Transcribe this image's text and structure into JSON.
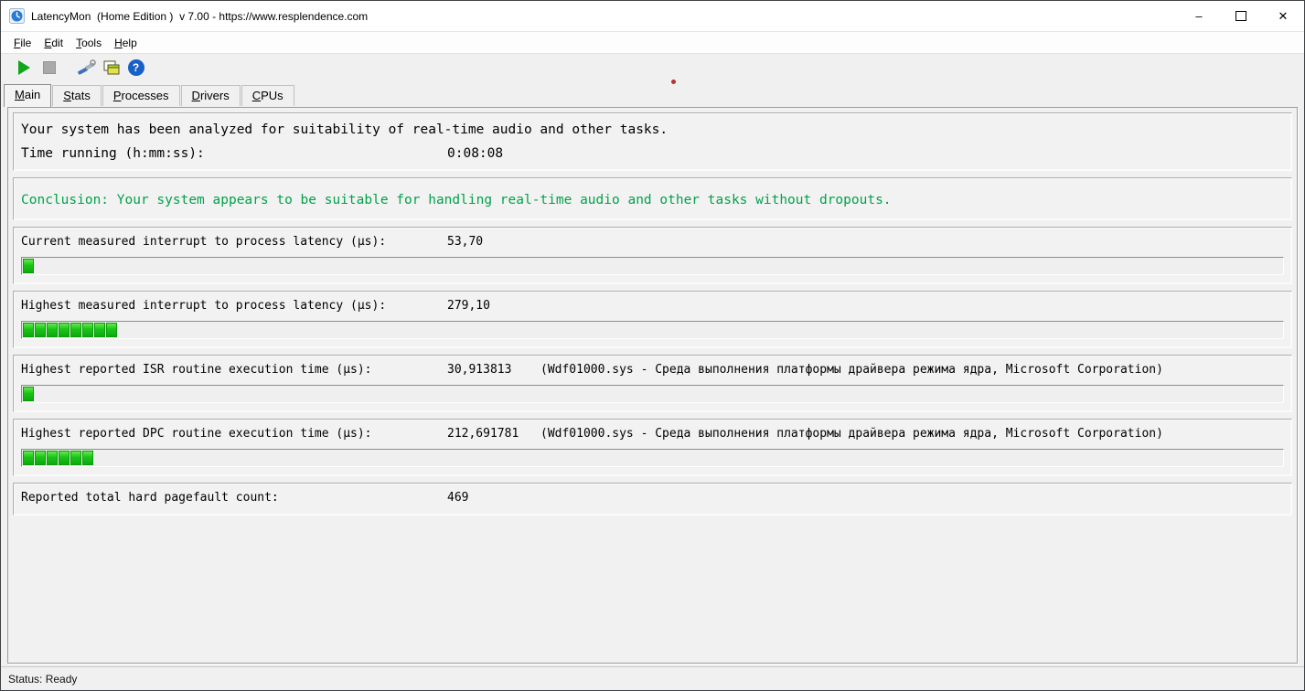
{
  "window": {
    "title": "LatencyMon  (Home Edition )  v 7.00 - https://www.resplendence.com"
  },
  "menubar": {
    "items": [
      {
        "label": "File"
      },
      {
        "label": "Edit"
      },
      {
        "label": "Tools"
      },
      {
        "label": "Help"
      }
    ]
  },
  "toolbar": {
    "buttons": [
      {
        "name": "start-monitor"
      },
      {
        "name": "stop-monitor"
      },
      {
        "name": "edit-options"
      },
      {
        "name": "copy-report"
      },
      {
        "name": "help"
      }
    ],
    "help_glyph": "?"
  },
  "tabs": [
    {
      "label": "Main",
      "active": true
    },
    {
      "label": "Stats",
      "active": false
    },
    {
      "label": "Processes",
      "active": false
    },
    {
      "label": "Drivers",
      "active": false
    },
    {
      "label": "CPUs",
      "active": false
    }
  ],
  "report": {
    "intro": "Your system has been analyzed for suitability of real-time audio and other tasks.",
    "time_running_label": "Time running (h:mm:ss):",
    "time_running_value": "0:08:08",
    "conclusion": "Conclusion: Your system appears to be suitable for handling real-time audio and other tasks without dropouts.",
    "metrics": [
      {
        "label": "Current measured interrupt to process latency (µs):",
        "value": "53,70",
        "detail": "",
        "bar_segments": 1
      },
      {
        "label": "Highest measured interrupt to process latency (µs):",
        "value": "279,10",
        "detail": "",
        "bar_segments": 8
      },
      {
        "label": "Highest reported ISR routine execution time (µs):",
        "value": "30,913813",
        "detail": "(Wdf01000.sys - Среда выполнения платформы драйвера режима ядра, Microsoft Corporation)",
        "bar_segments": 1
      },
      {
        "label": "Highest reported DPC routine execution time (µs):",
        "value": "212,691781",
        "detail": "(Wdf01000.sys - Среда выполнения платформы драйвера режима ядра, Microsoft Corporation)",
        "bar_segments": 6
      },
      {
        "label": "Reported total hard pagefault count:",
        "value": "469",
        "detail": "",
        "bar_segments": null
      }
    ]
  },
  "statusbar": {
    "text": "Status: Ready"
  },
  "colors": {
    "conclusion_green": "#00a24a",
    "bar_green": "#17c617",
    "play_green": "#12a41b",
    "help_blue": "#1660c8",
    "red_dot": "#b5342c"
  }
}
